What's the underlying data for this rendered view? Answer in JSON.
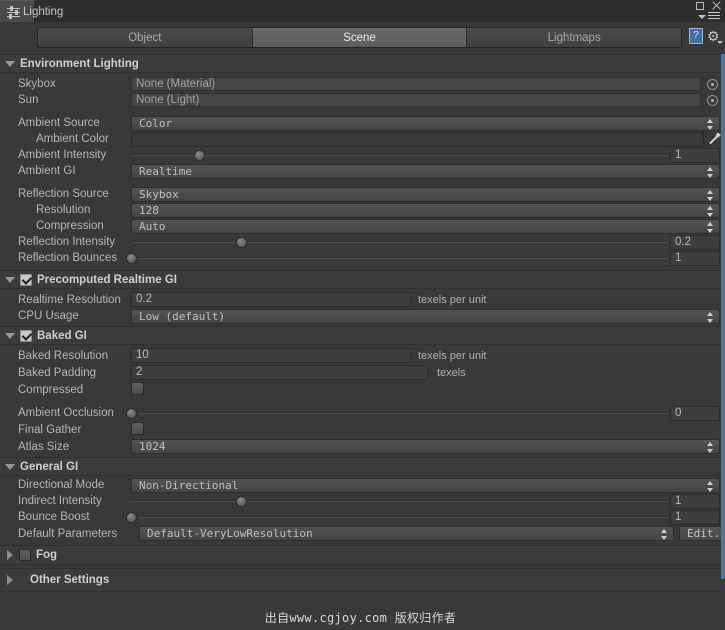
{
  "window": {
    "tab_title": "Lighting",
    "icon": "lighting-settings-icon",
    "buttons": {
      "maximize": "□",
      "close": "✕",
      "menu": "≡"
    }
  },
  "toolbar": {
    "tabs": [
      {
        "label": "Object",
        "active": false
      },
      {
        "label": "Scene",
        "active": true
      },
      {
        "label": "Lightmaps",
        "active": false
      }
    ],
    "help_label": "?",
    "gear_label": "⚙"
  },
  "sections": {
    "environment_lighting": {
      "title": "Environment Lighting",
      "expanded": true,
      "skybox": {
        "label": "Skybox",
        "value": "None (Material)"
      },
      "sun": {
        "label": "Sun",
        "value": "None (Light)"
      },
      "ambient_source": {
        "label": "Ambient Source",
        "value": "Color"
      },
      "ambient_color": {
        "label": "Ambient Color",
        "value": "#1e1410",
        "alpha_color": "#ffffff"
      },
      "ambient_intensity": {
        "label": "Ambient Intensity",
        "value": "1",
        "slider_pct": 12
      },
      "ambient_gi": {
        "label": "Ambient GI",
        "value": "Realtime"
      },
      "reflection_source": {
        "label": "Reflection Source",
        "value": "Skybox"
      },
      "resolution": {
        "label": "Resolution",
        "value": "128"
      },
      "compression": {
        "label": "Compression",
        "value": "Auto"
      },
      "reflection_intensity": {
        "label": "Reflection Intensity",
        "value": "0.2",
        "slider_pct": 20
      },
      "reflection_bounces": {
        "label": "Reflection Bounces",
        "value": "1",
        "slider_pct": 0
      }
    },
    "precomputed_realtime_gi": {
      "title": "Precomputed Realtime GI",
      "checked": true,
      "expanded": true,
      "realtime_resolution": {
        "label": "Realtime Resolution",
        "value": "0.2",
        "unit": "texels per unit"
      },
      "cpu_usage": {
        "label": "CPU Usage",
        "value": "Low (default)"
      }
    },
    "baked_gi": {
      "title": "Baked GI",
      "checked": true,
      "expanded": true,
      "baked_resolution": {
        "label": "Baked Resolution",
        "value": "10",
        "unit": "texels per unit"
      },
      "baked_padding": {
        "label": "Baked Padding",
        "value": "2",
        "unit": "texels"
      },
      "compressed": {
        "label": "Compressed",
        "checked": false
      },
      "ambient_occlusion": {
        "label": "Ambient Occlusion",
        "value": "0",
        "slider_pct": 0
      },
      "final_gather": {
        "label": "Final Gather",
        "checked": false
      },
      "atlas_size": {
        "label": "Atlas Size",
        "value": "1024"
      }
    },
    "general_gi": {
      "title": "General GI",
      "expanded": true,
      "directional_mode": {
        "label": "Directional Mode",
        "value": "Non-Directional"
      },
      "indirect_intensity": {
        "label": "Indirect Intensity",
        "value": "1",
        "slider_pct": 20
      },
      "bounce_boost": {
        "label": "Bounce Boost",
        "value": "1",
        "slider_pct": 0
      },
      "default_parameters": {
        "label": "Default Parameters",
        "value": "Default-VeryLowResolution",
        "edit_label": "Edit..."
      }
    },
    "fog": {
      "title": "Fog",
      "checked": false,
      "expanded": false
    },
    "other_settings": {
      "title": "Other Settings",
      "expanded": false
    }
  },
  "watermark": "出自www.cgjoy.com 版权归作者",
  "colors": {
    "panel_bg": "#393939",
    "accent_scrollbar": "#4875b0",
    "help_blue": "#3d6ea8"
  }
}
